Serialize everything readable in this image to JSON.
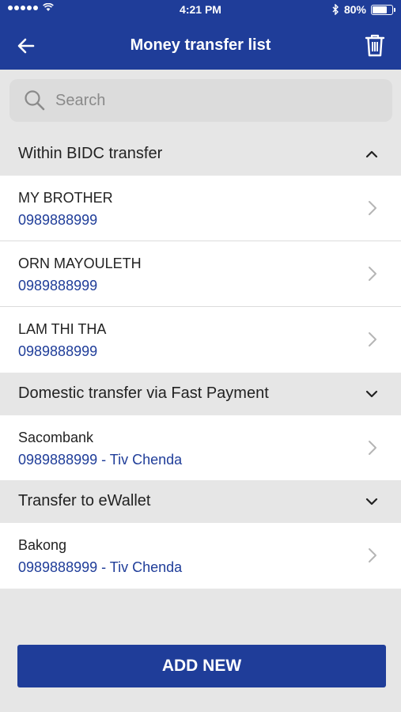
{
  "status_bar": {
    "time": "4:21 PM",
    "battery_text": "80%",
    "battery_level": 0.8,
    "icons": [
      "signal-dots-icon",
      "wifi-icon",
      "bluetooth-icon",
      "battery-icon"
    ]
  },
  "header": {
    "title": "Money transfer list",
    "back_icon": "back-arrow-icon",
    "delete_icon": "trash-icon"
  },
  "search": {
    "placeholder": "Search",
    "value": ""
  },
  "sections": [
    {
      "title": "Within BIDC transfer",
      "expanded": true,
      "items": [
        {
          "name": "MY BROTHER",
          "detail": "0989888999"
        },
        {
          "name": "ORN MAYOULETH",
          "detail": "0989888999"
        },
        {
          "name": "LAM THI THA",
          "detail": "0989888999"
        }
      ]
    },
    {
      "title": "Domestic transfer via Fast Payment",
      "expanded": false,
      "items": [
        {
          "name": "Sacombank",
          "detail": "0989888999 - Tiv Chenda"
        }
      ]
    },
    {
      "title": "Transfer to eWallet",
      "expanded": false,
      "items": [
        {
          "name": "Bakong",
          "detail": "0989888999 - Tiv Chenda"
        }
      ]
    }
  ],
  "actions": {
    "add_new_label": "ADD NEW"
  },
  "colors": {
    "primary": "#1f3d99",
    "background": "#e6e6e6",
    "row_background": "#ffffff",
    "detail_text": "#1f3d99"
  }
}
